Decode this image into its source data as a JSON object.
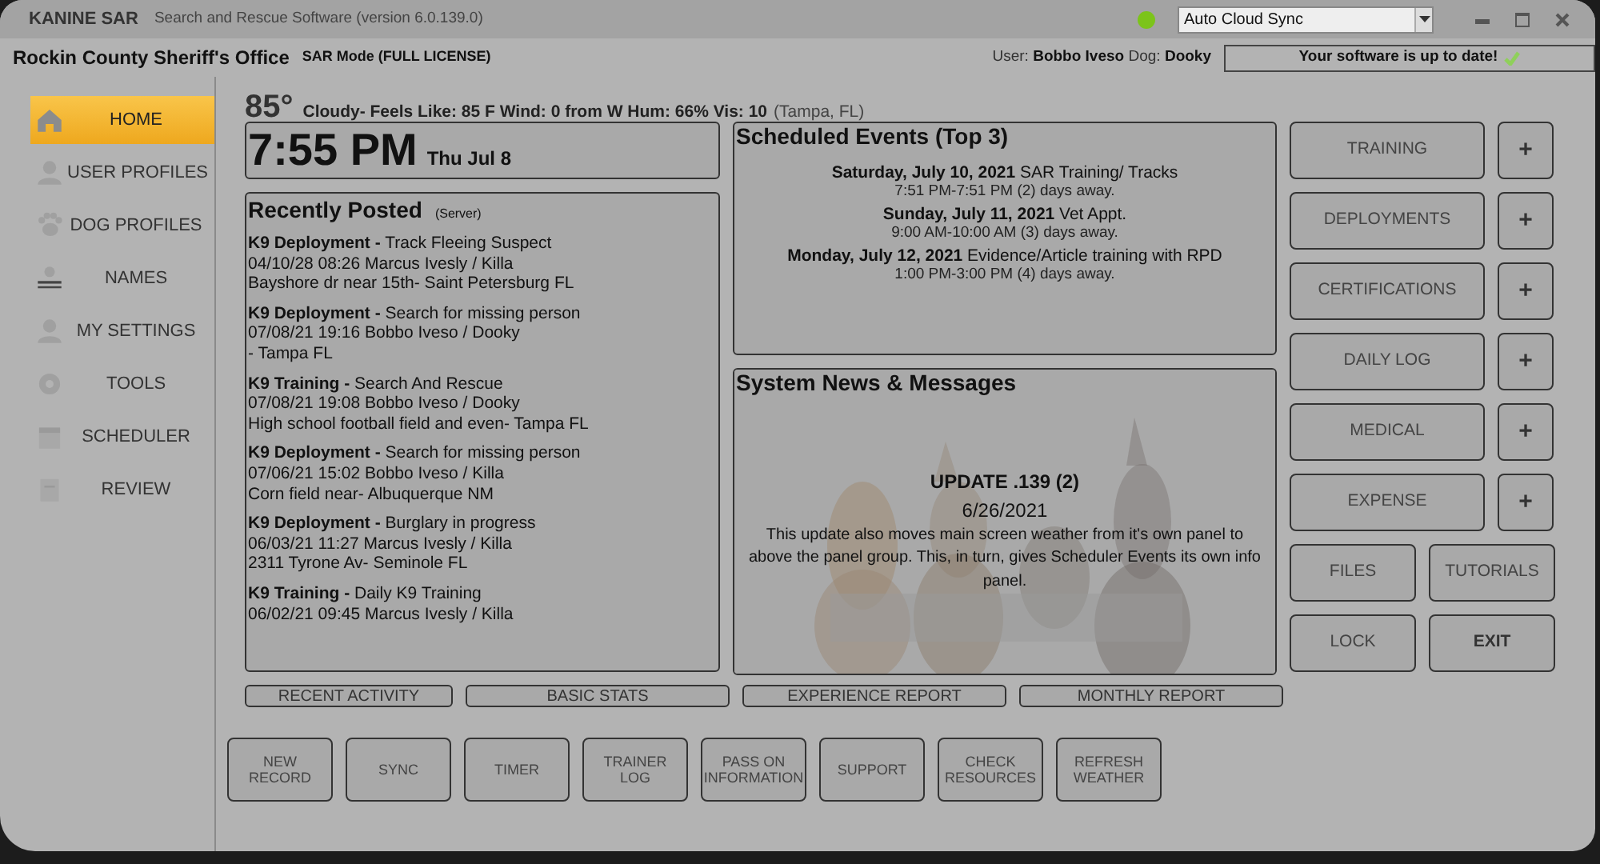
{
  "window": {
    "title": "KANINE SAR",
    "subtitle": "Search and Rescue Software (version 6.0.139.0)"
  },
  "sync": {
    "online": true,
    "value": "Auto Cloud Sync"
  },
  "header": {
    "organization": "Rockin County Sheriff's Office",
    "mode": "SAR Mode (FULL LICENSE)",
    "user_label": "User:",
    "user": "Bobbo Iveso",
    "dog_label": "Dog:",
    "dog": "Dooky",
    "update_status": "Your software is up to date!"
  },
  "sidebar": {
    "items": [
      {
        "label": "HOME",
        "selected": true
      },
      {
        "label": "USER PROFILES",
        "selected": false
      },
      {
        "label": "DOG PROFILES",
        "selected": false
      },
      {
        "label": "NAMES",
        "selected": false
      },
      {
        "label": "MY SETTINGS",
        "selected": false
      },
      {
        "label": "TOOLS",
        "selected": false
      },
      {
        "label": "SCHEDULER",
        "selected": false
      },
      {
        "label": "REVIEW",
        "selected": false
      }
    ]
  },
  "weather": {
    "temperature": "85°",
    "summary": "Cloudy- Feels Like: 85 F Wind: 0 from W Hum: 66%  Vis: 10",
    "location": "(Tampa, FL)"
  },
  "clock": {
    "time": "7:55 PM",
    "date": "Thu Jul 8"
  },
  "recent": {
    "title": "Recently Posted",
    "source": "(Server)",
    "posts": [
      {
        "category": "K9 Deployment -",
        "title": "Track Fleeing Suspect",
        "meta": "04/10/28 08:26 Marcus Ivesly / Killa",
        "location": "Bayshore dr near 15th- Saint Petersburg FL"
      },
      {
        "category": "K9 Deployment -",
        "title": "Search for missing person",
        "meta": "07/08/21 19:16 Bobbo Iveso / Dooky",
        "location": "- Tampa FL"
      },
      {
        "category": "K9 Training -",
        "title": "Search And Rescue",
        "meta": "07/08/21 19:08 Bobbo Iveso / Dooky",
        "location": "High school football field and even- Tampa FL"
      },
      {
        "category": "K9 Deployment -",
        "title": "Search for missing person",
        "meta": "07/06/21 15:02 Bobbo Iveso / Killa",
        "location": "Corn field near- Albuquerque NM"
      },
      {
        "category": "K9 Deployment -",
        "title": "Burglary in progress",
        "meta": "06/03/21 11:27 Marcus Ivesly / Killa",
        "location": "2311 Tyrone Av- Seminole FL"
      },
      {
        "category": "K9 Training -",
        "title": "Daily K9 Training",
        "meta": "06/02/21 09:45 Marcus Ivesly / Killa"
      }
    ]
  },
  "events": {
    "title": "Scheduled Events (Top 3)",
    "items": [
      {
        "date": "Saturday, July 10, 2021",
        "name": "SAR Training/ Tracks",
        "time": "7:51 PM-7:51 PM (2) days away."
      },
      {
        "date": "Sunday, July 11, 2021",
        "name": "Vet Appt.",
        "time": "9:00 AM-10:00 AM (3) days away."
      },
      {
        "date": "Monday, July 12, 2021",
        "name": "Evidence/Article training with RPD",
        "time": "1:00 PM-3:00 PM (4) days away."
      }
    ]
  },
  "news": {
    "title": "System News & Messages",
    "headline": "UPDATE .139 (2)",
    "date": "6/26/2021",
    "body": "This update also moves main screen weather from it's own panel to above the panel group. This, in turn, gives Scheduler Events its own info panel."
  },
  "report_buttons": [
    "RECENT ACTIVITY",
    "BASIC STATS",
    "EXPERIENCE REPORT",
    "MONTHLY REPORT"
  ],
  "modules": [
    {
      "label": "TRAINING",
      "add": "+"
    },
    {
      "label": "DEPLOYMENTS",
      "add": "+"
    },
    {
      "label": "CERTIFICATIONS",
      "add": "+"
    },
    {
      "label": "DAILY LOG",
      "add": "+"
    },
    {
      "label": "MEDICAL",
      "add": "+"
    },
    {
      "label": "EXPENSE",
      "add": "+"
    }
  ],
  "utility_buttons": [
    {
      "label": "FILES",
      "primary": false
    },
    {
      "label": "TUTORIALS",
      "primary": false
    },
    {
      "label": "LOCK",
      "primary": false
    },
    {
      "label": "EXIT",
      "primary": true
    }
  ],
  "toolbar": [
    "NEW RECORD",
    "SYNC",
    "TIMER",
    "TRAINER LOG",
    "PASS ON INFORMATION",
    "SUPPORT",
    "CHECK RESOURCES",
    "REFRESH WEATHER"
  ]
}
